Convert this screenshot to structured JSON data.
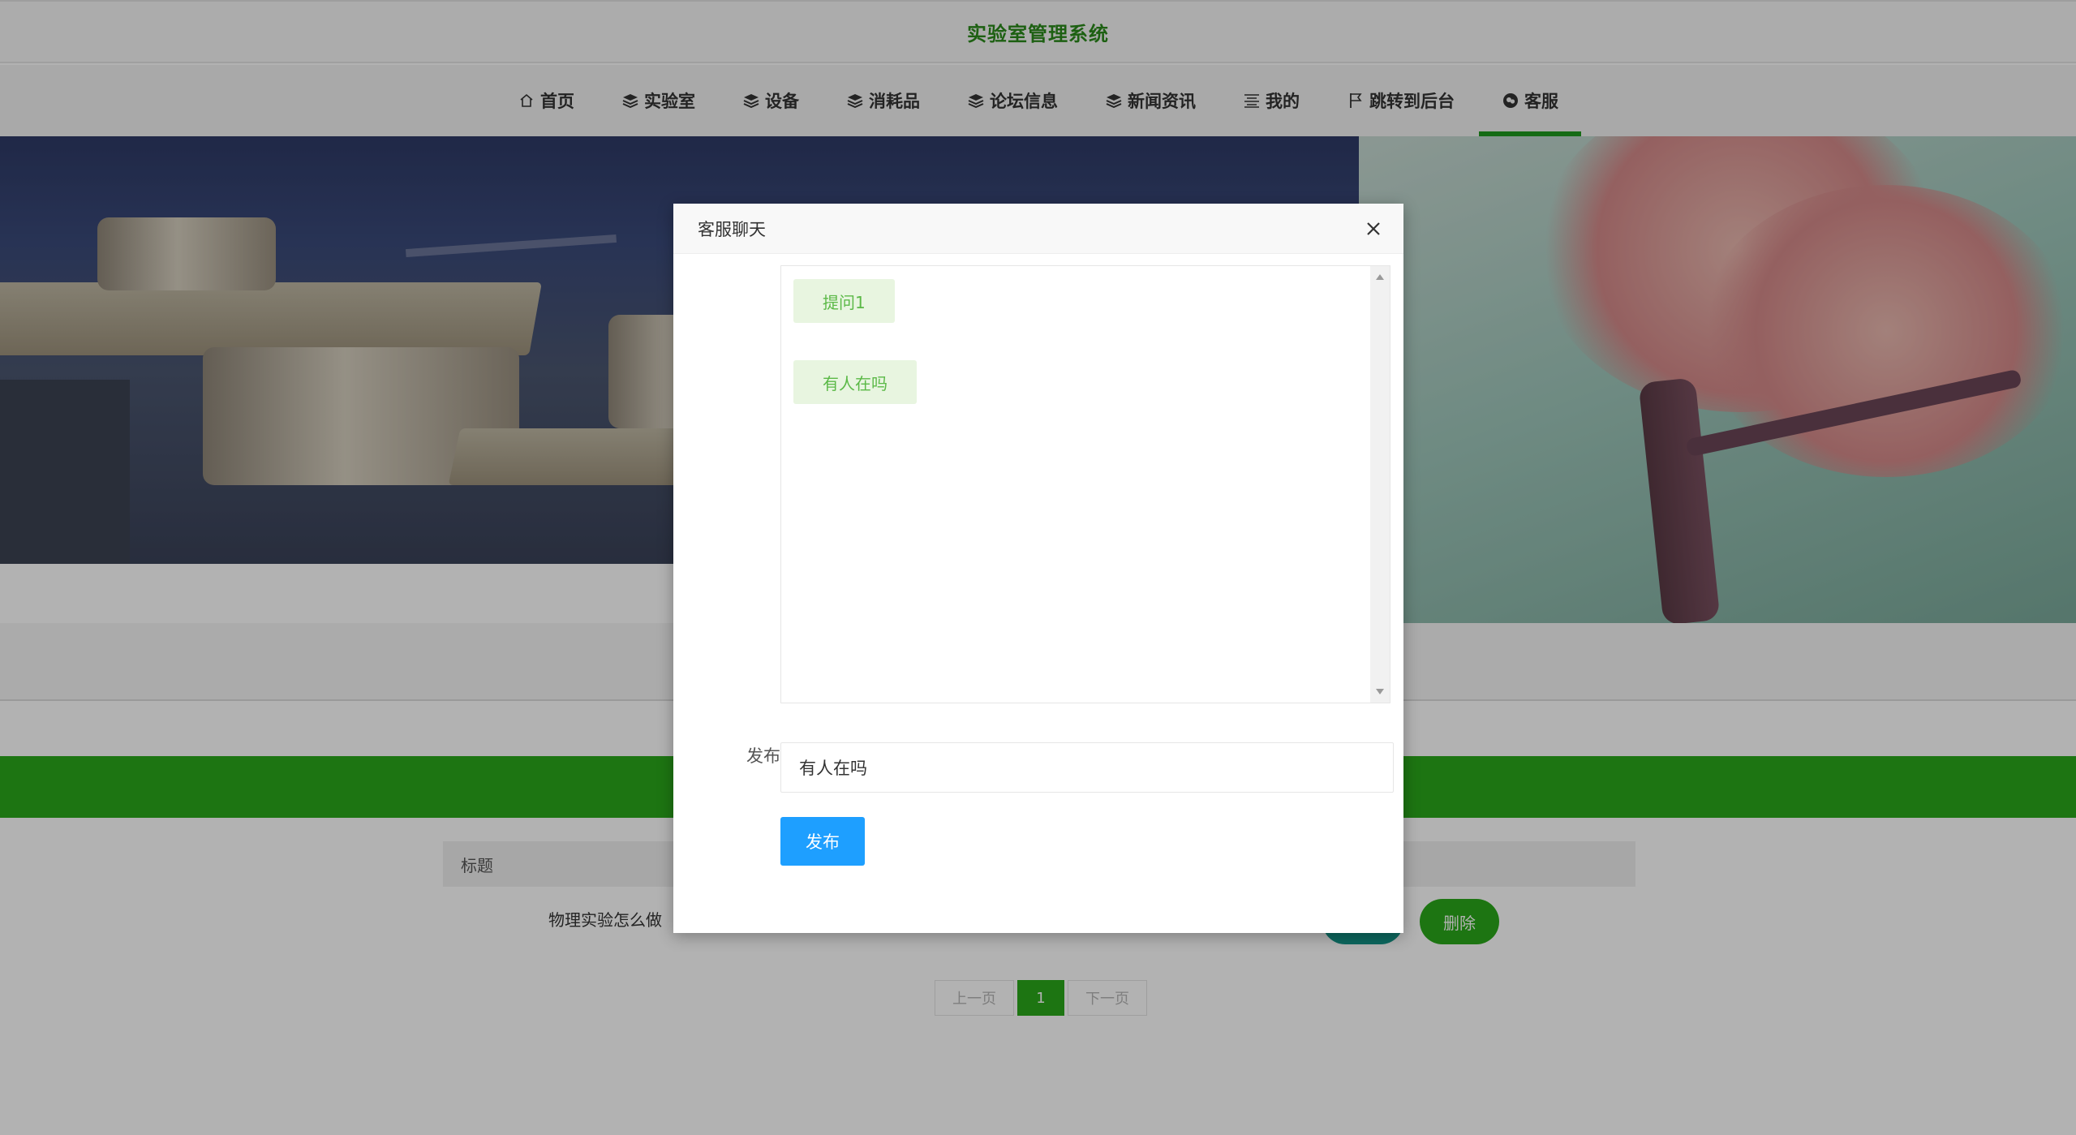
{
  "header": {
    "title": "实验室管理系统"
  },
  "nav": {
    "items": [
      {
        "label": "首页",
        "icon": "home-icon"
      },
      {
        "label": "实验室",
        "icon": "layers-icon"
      },
      {
        "label": "设备",
        "icon": "layers-icon"
      },
      {
        "label": "消耗品",
        "icon": "layers-icon"
      },
      {
        "label": "论坛信息",
        "icon": "layers-icon"
      },
      {
        "label": "新闻资讯",
        "icon": "layers-icon"
      },
      {
        "label": "我的",
        "icon": "menu-lines-icon"
      },
      {
        "label": "跳转到后台",
        "icon": "flag-icon"
      },
      {
        "label": "客服",
        "icon": "chat-icon"
      }
    ],
    "active_index": 8,
    "accent_color": "#1f9a1f"
  },
  "list": {
    "column_header": "标题",
    "rows": [
      {
        "title": "物理实验怎么做",
        "delete_label": "删除"
      }
    ]
  },
  "pagination": {
    "prev": "上一页",
    "current": "1",
    "next": "下一页"
  },
  "modal": {
    "title": "客服聊天",
    "messages": [
      "提问1",
      "有人在吗"
    ],
    "field_label": "发布",
    "input_value": "有人在吗",
    "submit_label": "发布"
  },
  "colors": {
    "brand_green": "#2aa81a",
    "button_blue": "#1e9fff",
    "bubble_text": "#5bb947"
  }
}
